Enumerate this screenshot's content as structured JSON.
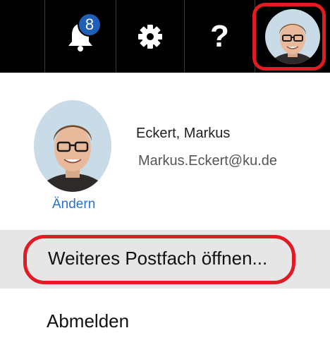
{
  "topbar": {
    "notifications": {
      "icon": "bell-icon",
      "count": "8"
    },
    "settings": {
      "icon": "gear-icon"
    },
    "help": {
      "icon": "help-icon",
      "glyph": "?"
    },
    "account": {
      "icon": "avatar"
    }
  },
  "profile": {
    "name": "Eckert, Markus",
    "email": "Markus.Eckert@ku.de",
    "change_link": "Ändern"
  },
  "menu": {
    "open_mailbox": "Weiteres Postfach öffnen...",
    "sign_out": "Abmelden"
  },
  "colors": {
    "topbar_bg": "#000000",
    "badge_bg": "#1f5fb8",
    "link": "#2a6fd6",
    "highlight": "#e01b24",
    "menu_hover_bg": "#e6e6e6"
  }
}
